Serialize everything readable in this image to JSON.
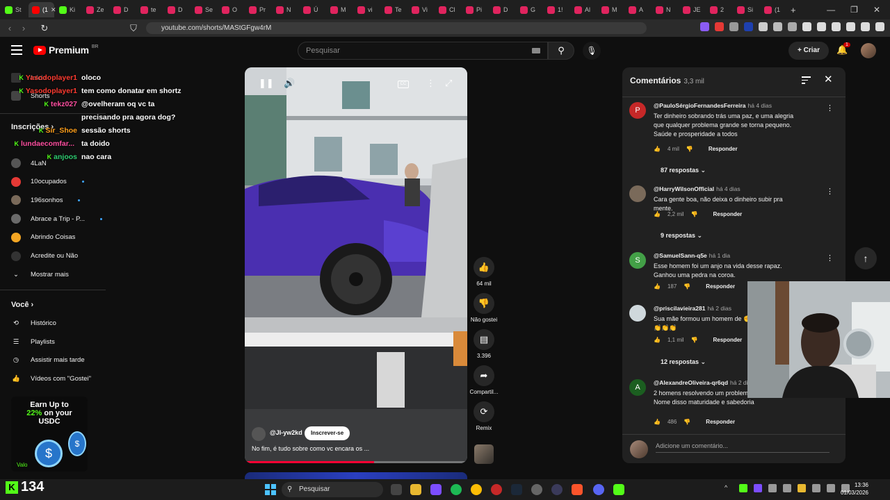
{
  "browser": {
    "tabs": [
      {
        "label": "St",
        "color": "#53fc18"
      },
      {
        "label": "(1",
        "color": "#ff0000",
        "active": true
      },
      {
        "label": "Ki",
        "color": "#53fc18"
      },
      {
        "label": "Ze",
        "color": "#e0245e"
      },
      {
        "label": "D",
        "color": "#e0245e"
      },
      {
        "label": "te",
        "color": "#e0245e"
      },
      {
        "label": "D",
        "color": "#e0245e"
      },
      {
        "label": "Se",
        "color": "#e0245e"
      },
      {
        "label": "O",
        "color": "#e0245e"
      },
      {
        "label": "Pr",
        "color": "#e0245e"
      },
      {
        "label": "N",
        "color": "#e0245e"
      },
      {
        "label": "Ú",
        "color": "#e0245e"
      },
      {
        "label": "M",
        "color": "#e0245e"
      },
      {
        "label": "vi",
        "color": "#e0245e"
      },
      {
        "label": "Te",
        "color": "#e0245e"
      },
      {
        "label": "Vi",
        "color": "#e0245e"
      },
      {
        "label": "Cl",
        "color": "#e0245e"
      },
      {
        "label": "Pi",
        "color": "#e0245e"
      },
      {
        "label": "D",
        "color": "#e0245e"
      },
      {
        "label": "G",
        "color": "#e0245e"
      },
      {
        "label": "1!",
        "color": "#e0245e"
      },
      {
        "label": "Al",
        "color": "#e0245e"
      },
      {
        "label": "M",
        "color": "#e0245e"
      },
      {
        "label": "A",
        "color": "#e0245e"
      },
      {
        "label": "N",
        "color": "#e0245e"
      },
      {
        "label": "JE",
        "color": "#e0245e"
      },
      {
        "label": "2",
        "color": "#e0245e"
      },
      {
        "label": "Si",
        "color": "#e0245e"
      },
      {
        "label": "(1",
        "color": "#e0245e"
      }
    ],
    "new_tab": "+",
    "url": "youtube.com/shorts/MAStGFgw4rM"
  },
  "header": {
    "brand": "Premium",
    "region": "BR",
    "search_placeholder": "Pesquisar",
    "create_label": "Criar",
    "notif_count": "1"
  },
  "sidebar": {
    "top_items": [
      {
        "label": "Início"
      },
      {
        "label": "Shorts"
      }
    ],
    "subs_title": "Inscrições",
    "subs": [
      {
        "label": "4LaN",
        "color": "#555",
        "dot": false
      },
      {
        "label": "10ocupados",
        "color": "#e53935",
        "dot": true
      },
      {
        "label": "196sonhos",
        "color": "#7a6a5a",
        "dot": true
      },
      {
        "label": "Abrace a Trip - P...",
        "color": "#6a6a6a",
        "dot": true
      },
      {
        "label": "Abrindo Coisas",
        "color": "#f5a623",
        "dot": false
      },
      {
        "label": "Acredite ou Não",
        "color": "#333",
        "dot": false
      }
    ],
    "show_more": "Mostrar mais",
    "you_title": "Você",
    "you_items": [
      {
        "label": "Histórico"
      },
      {
        "label": "Playlists"
      },
      {
        "label": "Assistir mais tarde"
      },
      {
        "label": "Vídeos com \"Gostei\""
      }
    ]
  },
  "chat": [
    {
      "user": "Yasodoplayer1",
      "color": "#ff3b30",
      "msg": "oloco"
    },
    {
      "user": "Yasodoplayer1",
      "color": "#ff3b30",
      "msg": "tem como donatar em shortz"
    },
    {
      "user": "tekz027",
      "color": "#ff4fa0",
      "msg": "@ovelheram oq vc ta"
    },
    {
      "user": "",
      "color": "#fff",
      "msg": "precisando pra agora dog?"
    },
    {
      "user": "Sir_Shoe",
      "color": "#ff9f1a",
      "msg": "sessão shorts"
    },
    {
      "user": "lundaecomfar...",
      "color": "#ff4fa0",
      "msg": "ta doido"
    },
    {
      "user": "anjoos",
      "color": "#2ecc71",
      "msg": "nao cara"
    }
  ],
  "video": {
    "channel": "@Jl-yw2kd",
    "subscribe": "Inscrever-se",
    "title": "No fim, é tudo sobre como vc encara os ...",
    "progress": 0.58,
    "cc": "CC"
  },
  "actions": {
    "likes": "64 mil",
    "dislike": "Não gostei",
    "comments": "3.396",
    "share": "Compartil...",
    "remix": "Remix"
  },
  "comments": {
    "title": "Comentários",
    "count": "3,3 mil",
    "items": [
      {
        "initial": "P",
        "color": "#c62828",
        "author": "@PauloSérgioFernandesFerreira",
        "time": "há 4 dias",
        "text": "Ter dinheiro sobrando trás uma paz, e uma alegria que qualquer problema grande se torna pequeno. Saúde e prosperidade a todos",
        "likes": "4 mil",
        "reply": "Responder",
        "replies": "87 respostas"
      },
      {
        "initial": "",
        "color": "#7a6a5a",
        "author": "@HarryWilsonOfficial",
        "time": "há 4 dias",
        "text": "Cara gente boa, não deixa o dinheiro subir pra mente.",
        "likes": "2,2 mil",
        "reply": "Responder",
        "replies": "9 respostas"
      },
      {
        "initial": "S",
        "color": "#43a047",
        "author": "@SamuelSann-q5e",
        "time": "há 1 dia",
        "text": "Esse homem foi um anjo na vida desse rapaz. Ganhou uma pedra na coroa.",
        "likes": "187",
        "reply": "Responder",
        "replies": ""
      },
      {
        "initial": "",
        "color": "#cfd8dc",
        "author": "@priscilavieira281",
        "time": "há 2 dias",
        "text": "Sua mãe formou um homem de ✊\n👏👏👏",
        "likes": "1,1 mil",
        "reply": "Responder",
        "replies": "12 respostas"
      },
      {
        "initial": "A",
        "color": "#1b5e20",
        "author": "@AlexandreOliveira-qr6qd",
        "time": "há 2 dias",
        "text": "2 homens resolvendo um problema sem discussão.\nNome disso maturidade e sabedoria",
        "likes": "486",
        "reply": "Responder",
        "replies": ""
      }
    ],
    "add_placeholder": "Adicione um comentário..."
  },
  "ad": {
    "line1": "Earn Up to",
    "highlight": "22%",
    "line2_rest": " on your",
    "line3": "USDC",
    "tag": "Valo"
  },
  "kick": {
    "count": "134"
  },
  "taskbar": {
    "search": "Pesquisar",
    "time": "13:36",
    "date": "01/03/2026"
  }
}
